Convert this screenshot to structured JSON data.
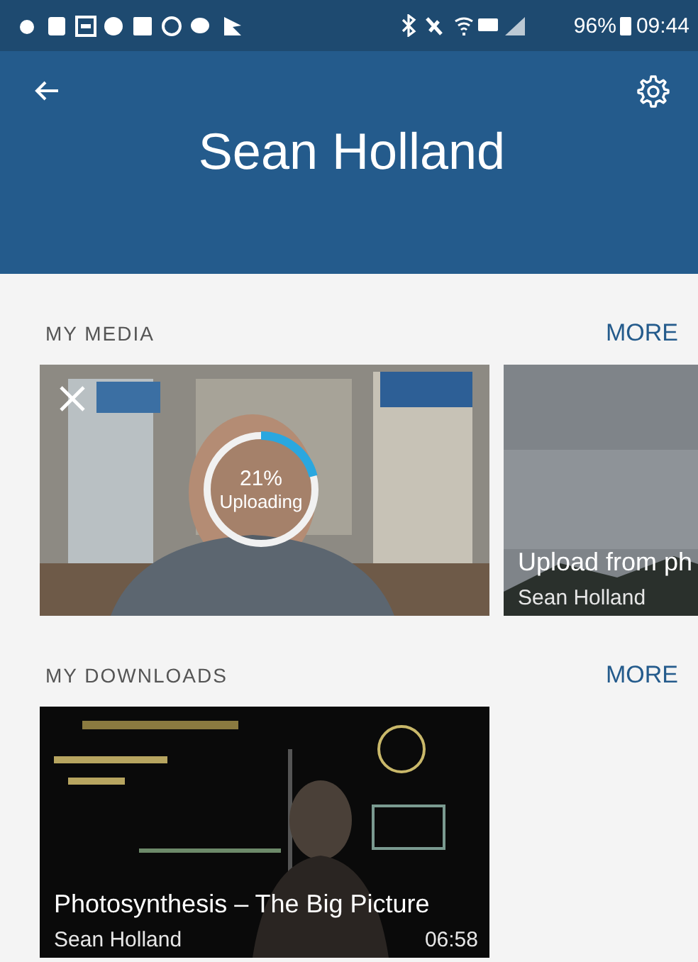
{
  "status_bar": {
    "battery": "96%",
    "time": "09:44"
  },
  "header": {
    "title": "Sean Holland"
  },
  "sections": [
    {
      "title": "MY MEDIA",
      "more": "MORE",
      "items": [
        {
          "kind": "uploading",
          "progress": {
            "level": 0.21,
            "percent": "21%",
            "label": "Uploading"
          }
        },
        {
          "kind": "video",
          "title": "Upload from ph",
          "author": "Sean Holland"
        }
      ]
    },
    {
      "title": "MY DOWNLOADS",
      "more": "MORE",
      "items": [
        {
          "kind": "video",
          "title": "Photosynthesis – The Big Picture",
          "author": "Sean Holland",
          "duration": "06:58"
        }
      ]
    }
  ]
}
